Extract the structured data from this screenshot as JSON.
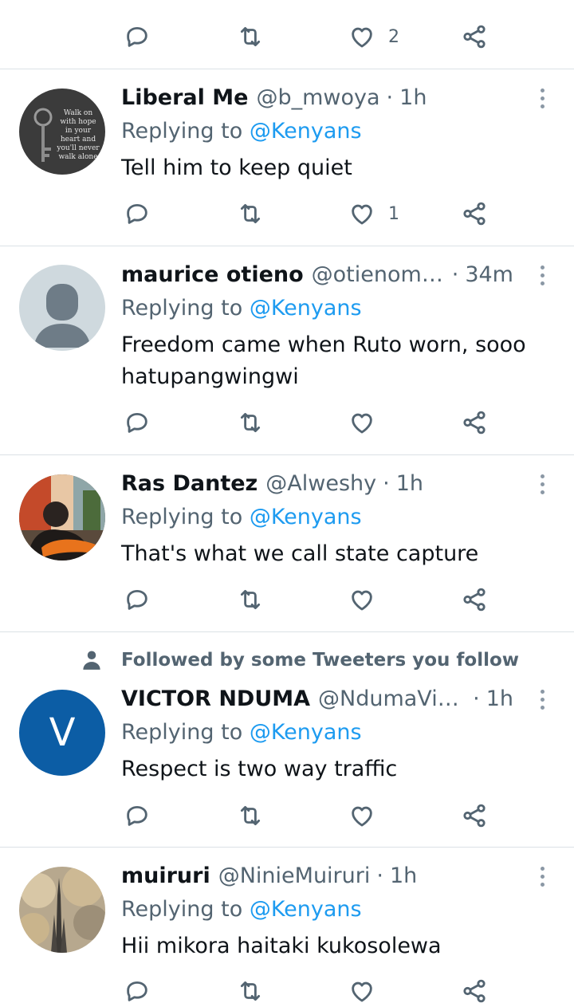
{
  "top_actions": {
    "like_count": "2"
  },
  "tweets": [
    {
      "name": "Liberal Me",
      "handle": "@b_mwoya",
      "time": "1h",
      "replying_prefix": "Replying to ",
      "replying_to": "@Kenyans",
      "text": "Tell him to keep quiet",
      "like_count": "1",
      "avatar_icon": "quote-art-avatar",
      "avatar_text": [
        "Walk on",
        "with hope",
        "in your",
        "heart and",
        "you'll never",
        "walk alone"
      ]
    },
    {
      "name": "maurice otieno",
      "handle": "@otienomac...",
      "time": "34m",
      "replying_prefix": "Replying to ",
      "replying_to": "@Kenyans",
      "text": "Freedom came when Ruto worn, sooo hatupangwingwi",
      "like_count": "",
      "avatar_icon": "default-user-avatar"
    },
    {
      "name": "Ras Dantez",
      "handle": "@Alweshy",
      "time": "1h",
      "replying_prefix": "Replying to ",
      "replying_to": "@Kenyans",
      "text": "That's what we call state capture",
      "like_count": "",
      "avatar_icon": "photo-avatar"
    },
    {
      "name": "VICTOR NDUMA",
      "handle": "@NdumaVictor",
      "time": "1h",
      "replying_prefix": "Replying to ",
      "replying_to": "@Kenyans",
      "text": "Respect is two way traffic",
      "like_count": "",
      "avatar_letter": "V",
      "social_context": "Followed by some Tweeters you follow"
    },
    {
      "name": "muiruri",
      "handle": "@NinieMuiruri",
      "time": "1h",
      "replying_prefix": "Replying to ",
      "replying_to": "@Kenyans",
      "text": "Hii mikora haitaki kukosolewa",
      "like_count": "",
      "avatar_icon": "skyline-photo-avatar"
    }
  ],
  "colors": {
    "name": "#0f1419",
    "secondary": "#536471",
    "mention": "#1d9bf0",
    "divider": "#dbe1e6",
    "letter_avatar_bg": "#0c5da5"
  },
  "icons": {
    "reply": "reply-icon",
    "retweet": "retweet-icon",
    "like": "heart-icon",
    "share": "share-icon",
    "more": "more-vertical-icon",
    "person": "person-icon"
  },
  "separator": "·"
}
